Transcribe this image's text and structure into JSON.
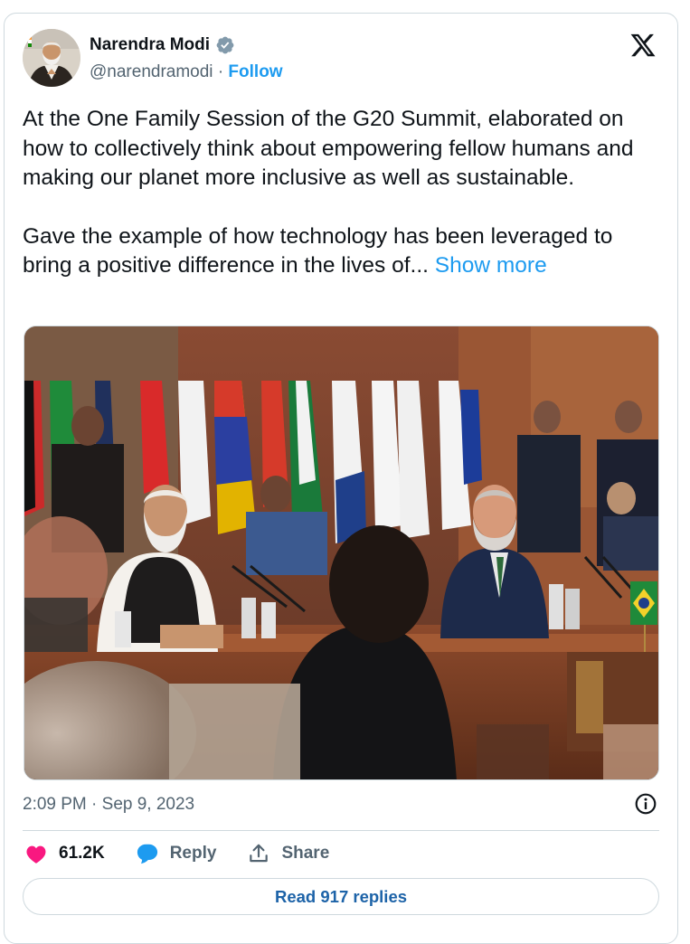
{
  "author": {
    "name": "Narendra Modi",
    "handle": "@narendramodi",
    "separator": "·",
    "follow_label": "Follow"
  },
  "tweet": {
    "paragraph1": "At the One Family Session of the G20 Summit, elaborated on how to collectively think about empowering fellow humans and making our planet more inclusive as well as sustainable.",
    "paragraph2": "Gave the example of how technology has been leveraged to bring a positive difference in the lives of...",
    "show_more_label": "Show more",
    "timestamp": "2:09 PM · Sep 9, 2023"
  },
  "actions": {
    "likes_count": "61.2K",
    "reply_label": "Reply",
    "share_label": "Share"
  },
  "read_replies_label": "Read 917 replies",
  "icons": {
    "verified": "verified-badge-icon",
    "x_logo": "x-logo-icon",
    "heart": "heart-icon",
    "reply": "reply-bubble-icon",
    "share": "share-upload-icon",
    "info": "info-icon"
  },
  "colors": {
    "accent": "#1d9bf0",
    "heart": "#f91880",
    "secondary_text": "#536471",
    "border": "#cfd9de",
    "read_replies_text": "#1d63a8"
  }
}
